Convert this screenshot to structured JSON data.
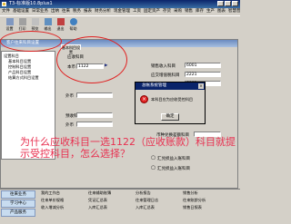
{
  "window": {
    "title": "T3-标准版10.8plus1"
  },
  "menu": [
    "文件",
    "基础设置",
    "日常业务",
    "出纳",
    "往来",
    "税务",
    "报表",
    "财务分析",
    "现金管理",
    "工资",
    "固定资产",
    "存货",
    "采购",
    "销售",
    "库存",
    "生产",
    "图表",
    "智慧营",
    "管理",
    "窗口",
    "帮助"
  ],
  "toolbar": {
    "items": [
      "设置",
      "打印",
      "预览",
      "输出",
      "退出",
      "帮助"
    ]
  },
  "subwindow": {
    "title": "客户往来科目设置"
  },
  "tab": {
    "label": "基本科目设置"
  },
  "tree": [
    "设置科目",
    "基本科目设置",
    "控制科目设置",
    "产品科目设置",
    "结算方式科目设置"
  ],
  "form": {
    "receivable_label": "应收科目",
    "currency_label": "本币",
    "receivable_value": "1122",
    "sales_income_label": "销售收入科目",
    "sales_income_value": "6001",
    "tax_label": "应交增值税科目",
    "tax_value": "2221",
    "return_label": "销售退回科目",
    "return_value": "6001",
    "foreign_label": "外币",
    "prepay_label": "预收科目",
    "prepay_label2": "外币",
    "other_label": "币种兑换差额科目",
    "option1": "汇兑损益入账科目",
    "option2": "汇兑损益入账科目"
  },
  "dialog": {
    "title": "总帐系统管理",
    "message": "本科目应为应收受控科目",
    "ok_label": "确定",
    "icon": "error-icon"
  },
  "overlay": {
    "line1": "为什么应收科目一选1122（应收账款）科目就提",
    "line2": "示受控科目，怎么选择？"
  },
  "sidebar": [
    "往来业务",
    "学习中心",
    "产品服务"
  ],
  "links": [
    "我的工作台",
    "往来辅助账簿",
    "分析报告",
    "销售分析",
    "往来单价规格",
    "凭证汇总表",
    "往来管理日志",
    "往来账龄分析",
    "收入增减分析",
    "入库汇总表",
    "入库汇总表",
    "销售日报表"
  ],
  "colors": {
    "title_bar": "#0a246a",
    "annotation": "#e83050",
    "circle": "#e02020"
  }
}
